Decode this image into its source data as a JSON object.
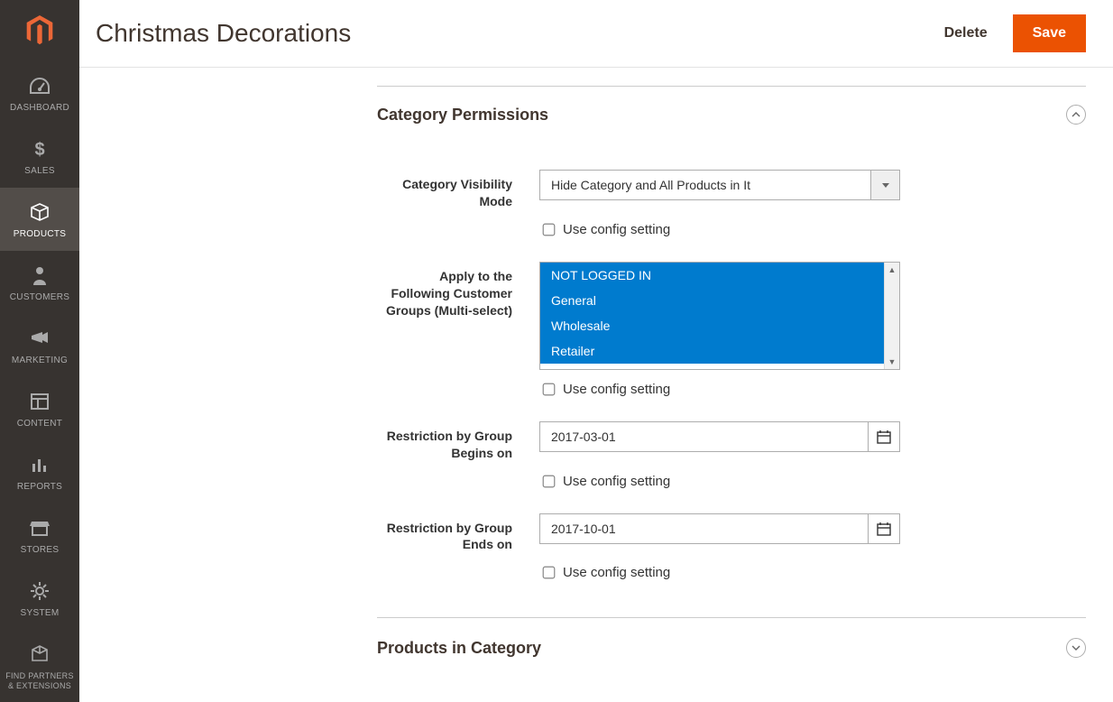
{
  "page": {
    "title": "Christmas Decorations"
  },
  "header": {
    "delete": "Delete",
    "save": "Save"
  },
  "sidebar": {
    "items": [
      {
        "key": "dashboard",
        "label": "DASHBOARD"
      },
      {
        "key": "sales",
        "label": "SALES"
      },
      {
        "key": "products",
        "label": "PRODUCTS"
      },
      {
        "key": "customers",
        "label": "CUSTOMERS"
      },
      {
        "key": "marketing",
        "label": "MARKETING"
      },
      {
        "key": "content",
        "label": "CONTENT"
      },
      {
        "key": "reports",
        "label": "REPORTS"
      },
      {
        "key": "stores",
        "label": "STORES"
      },
      {
        "key": "system",
        "label": "SYSTEM"
      },
      {
        "key": "find",
        "label": "FIND PARTNERS & EXTENSIONS"
      }
    ]
  },
  "sections": {
    "permissions": {
      "title": "Category Permissions",
      "visibility_mode": {
        "label": "Category Visibility Mode",
        "value": "Hide Category and All Products in It",
        "use_config_label": "Use config setting"
      },
      "groups": {
        "label": "Apply to the Following Customer Groups (Multi-select)",
        "options": [
          "NOT LOGGED IN",
          "General",
          "Wholesale",
          "Retailer"
        ],
        "use_config_label": "Use config setting"
      },
      "begin": {
        "label": "Restriction by Group Begins on",
        "value": "2017-03-01",
        "use_config_label": "Use config setting"
      },
      "end": {
        "label": "Restriction by Group Ends on",
        "value": "2017-10-01",
        "use_config_label": "Use config setting"
      }
    },
    "products": {
      "title": "Products in Category"
    }
  }
}
